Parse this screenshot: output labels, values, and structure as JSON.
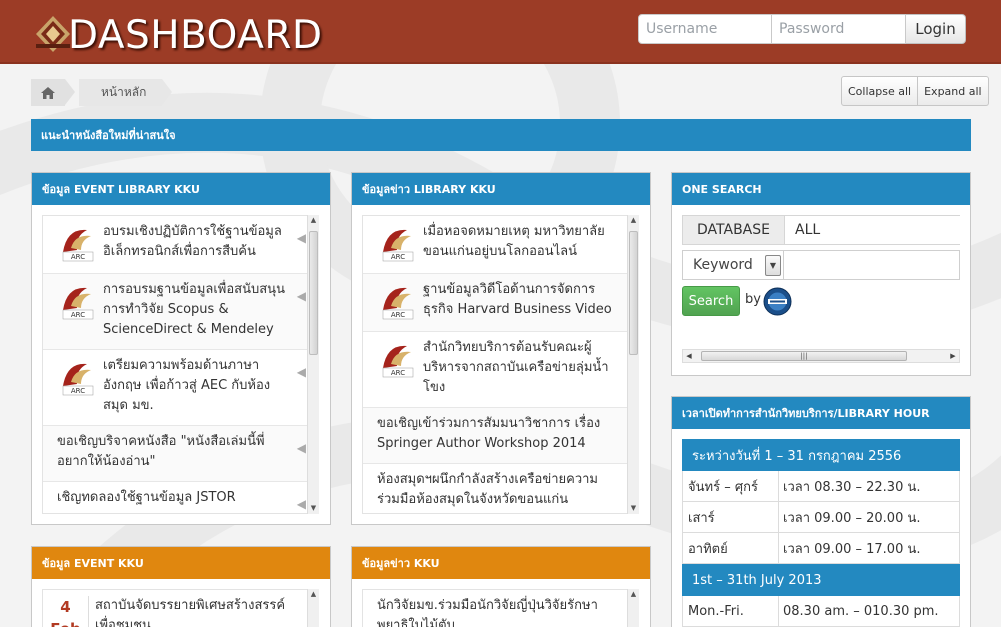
{
  "header": {
    "brand": "DASHBOARD",
    "username_placeholder": "Username",
    "password_placeholder": "Password",
    "login_label": "Login",
    "bg_color": "#9c3c26"
  },
  "breadcrumb": {
    "home_icon": "home-icon",
    "current": "หน้าหลัก"
  },
  "toolbar": {
    "collapse_all": "Collapse all",
    "expand_all": "Expand all"
  },
  "banner": {
    "title": "แนะนำหนังสือใหม่ที่น่าสนใจ"
  },
  "event_library": {
    "title": "ข้อมูล EVENT LIBRARY KKU",
    "items": [
      {
        "text": "อบรมเชิงปฏิบัติการใช้ฐานข้อมูลอิเล็กทรอนิกส์เพื่อการสืบค้น",
        "has_logo": true
      },
      {
        "text": "การอบรมฐานข้อมูลเพื่อสนับสนุนการทำวิจัย Scopus & ScienceDirect & Mendeley",
        "has_logo": true
      },
      {
        "text": "เตรียมความพร้อมด้านภาษาอังกฤษ เพื่อก้าวสู่ AEC กับห้องสมุด มข.",
        "has_logo": true
      },
      {
        "text": "ขอเชิญบริจาคหนังสือ \"หนังสือเล่มนี้พี่อยากให้น้องอ่าน\"",
        "has_logo": false
      },
      {
        "text": "เชิญทดลองใช้ฐานข้อมูล JSTOR",
        "has_logo": false
      }
    ]
  },
  "news_library": {
    "title": "ข้อมูลข่าว LIBRARY KKU",
    "items": [
      {
        "text": "เมื่อหอจดหมายเหตุ มหาวิทยาลัยขอนแก่นอยู่บนโลกออนไลน์",
        "has_logo": true
      },
      {
        "text": "ฐานข้อมูลวิดีโอด้านการจัดการธุรกิจ Harvard Business Video",
        "has_logo": true
      },
      {
        "text": "สำนักวิทยบริการต้อนรับคณะผู้บริหารจากสถาบันเครือข่ายลุ่มน้ำโขง",
        "has_logo": true
      },
      {
        "text": "ขอเชิญเข้าร่วมการสัมมนาวิชาการ เรื่อง Springer Author Workshop 2014",
        "has_logo": false
      },
      {
        "text": "ห้องสมุดฯผนึกกำลังสร้างเครือข่ายความร่วมมือห้องสมุดในจังหวัดขอนแก่น",
        "has_logo": false
      }
    ]
  },
  "one_search": {
    "title": "ONE SEARCH",
    "database_label": "DATABASE",
    "database_value": "ALL",
    "keyword_option": "Keyword",
    "search_label": "Search",
    "by_label": "by",
    "provider_icon": "ebsco-logo-icon"
  },
  "library_hour": {
    "title": "เวลาเปิดทำการสำนักวิทยบริการ/LIBRARY HOUR",
    "th_period": "ระหว่างวันที่ 1 – 31 กรกฎาคม 2556",
    "th_rows": [
      {
        "day": "จันทร์ – ศุกร์",
        "time": "เวลา 08.30 – 22.30 น."
      },
      {
        "day": "เสาร์",
        "time": "เวลา 09.00 – 20.00 น."
      },
      {
        "day": "อาทิตย์",
        "time": "เวลา 09.00 – 17.00 น."
      }
    ],
    "en_period": "1st – 31th July 2013",
    "en_rows": [
      {
        "day": "Mon.-Fri.",
        "time": "08.30 am. – 010.30 pm."
      }
    ]
  },
  "event_kku": {
    "title": "ข้อมูล EVENT KKU",
    "items": [
      {
        "day": "4",
        "month": "Feb",
        "text": "สถาบันจัดบรรยายพิเศษสร้างสรรค์เพื่อชุมชน"
      }
    ]
  },
  "news_kku": {
    "title": "ข้อมูลข่าว KKU",
    "items": [
      {
        "text": "นักวิจัยมข.ร่วมมือนักวิจัยญี่ปุ่นวิจัยรักษาพยาธิใบไม้ตับ"
      }
    ]
  },
  "colors": {
    "accent_blue": "#2389c0",
    "accent_orange": "#e0870f",
    "search_green": "#5bb75b"
  }
}
